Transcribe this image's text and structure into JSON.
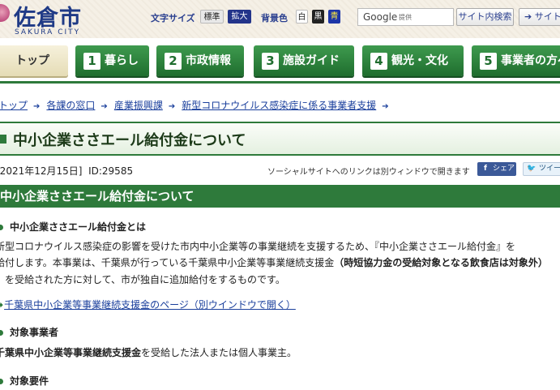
{
  "header": {
    "logo_title": "佐倉市",
    "logo_sub": "SAKURA CITY",
    "text_size_label": "文字サイズ",
    "size_standard": "標準",
    "size_large": "拡大",
    "bgcolor_label": "背景色",
    "bg_white": "白",
    "bg_black": "黒",
    "bg_blue": "青",
    "search_engine": "Google",
    "search_engine_note": "提供",
    "site_search_button": "サイト内検索",
    "sitemap_link": "サイトマップ"
  },
  "nav": {
    "tabs": [
      {
        "num": "",
        "label": "トップ"
      },
      {
        "num": "1",
        "label": "暮らし"
      },
      {
        "num": "2",
        "label": "市政情報"
      },
      {
        "num": "3",
        "label": "施設ガイド"
      },
      {
        "num": "4",
        "label": "観光・文化"
      },
      {
        "num": "5",
        "label": "事業者の方へ"
      }
    ]
  },
  "breadcrumb": [
    "トップ",
    "各課の窓口",
    "産業振興課",
    "新型コロナウイルス感染症に係る事業者支援"
  ],
  "page": {
    "title": "中小企業ささエール給付金について",
    "date": "[2021年12月15日]",
    "id": "ID:29585",
    "social_note": "ソーシャルサイトへのリンクは別ウィンドウで開きます",
    "share_facebook": "シェア",
    "share_twitter": "ツイート"
  },
  "section": {
    "title": "中小企業ささエール給付金について",
    "h_about": "中小企業ささエール給付金とは",
    "about_line1": "新型コロナウイルス感染症の影響を受けた市内中小企業等の事業継続を支援するため、『中小企業ささエール給付金』を",
    "about_line2_a": "給付します。本事業は、千葉県が行っている千葉県中小企業等事業継続支援金",
    "about_line2_b": "（時短協力金の受給対象となる飲食店は対象外）",
    "about_line3": "）を受給された方に対して、市が独自に追加給付をするものです。",
    "link_support": "千葉県中小企業等事業継続支援金のページ（別ウインドウで開く）",
    "h_target": "対象事業者",
    "target_bold": "千葉県中小企業等事業継続支援金",
    "target_rest": "を受給した法人または個人事業主。",
    "h_requirements": "対象要件"
  }
}
